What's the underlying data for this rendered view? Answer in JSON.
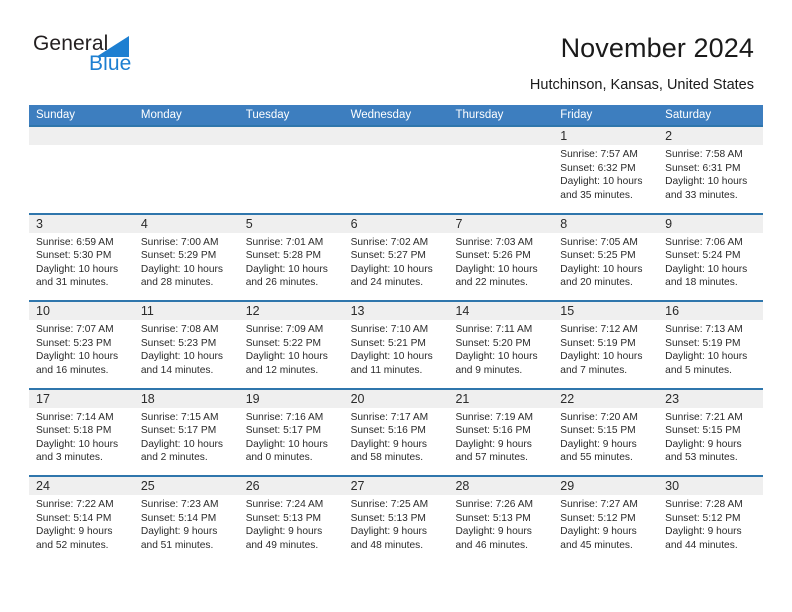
{
  "branding": {
    "logo_text_primary": "General",
    "logo_text_secondary": "Blue",
    "logo_icon": "triangle-icon",
    "accent_blue": "#1d7fd1"
  },
  "header": {
    "title": "November 2024",
    "location": "Hutchinson, Kansas, United States"
  },
  "colors": {
    "header_bar": "#3d7ebf",
    "row_divider": "#2f76ac",
    "daynum_strip": "#efefef",
    "text": "#2b2b2b"
  },
  "weekday_headers": [
    "Sunday",
    "Monday",
    "Tuesday",
    "Wednesday",
    "Thursday",
    "Friday",
    "Saturday"
  ],
  "weeks": [
    [
      {
        "day": "",
        "sunrise": "",
        "sunset": "",
        "daylight": ""
      },
      {
        "day": "",
        "sunrise": "",
        "sunset": "",
        "daylight": ""
      },
      {
        "day": "",
        "sunrise": "",
        "sunset": "",
        "daylight": ""
      },
      {
        "day": "",
        "sunrise": "",
        "sunset": "",
        "daylight": ""
      },
      {
        "day": "",
        "sunrise": "",
        "sunset": "",
        "daylight": ""
      },
      {
        "day": "1",
        "sunrise": "Sunrise: 7:57 AM",
        "sunset": "Sunset: 6:32 PM",
        "daylight": "Daylight: 10 hours and 35 minutes."
      },
      {
        "day": "2",
        "sunrise": "Sunrise: 7:58 AM",
        "sunset": "Sunset: 6:31 PM",
        "daylight": "Daylight: 10 hours and 33 minutes."
      }
    ],
    [
      {
        "day": "3",
        "sunrise": "Sunrise: 6:59 AM",
        "sunset": "Sunset: 5:30 PM",
        "daylight": "Daylight: 10 hours and 31 minutes."
      },
      {
        "day": "4",
        "sunrise": "Sunrise: 7:00 AM",
        "sunset": "Sunset: 5:29 PM",
        "daylight": "Daylight: 10 hours and 28 minutes."
      },
      {
        "day": "5",
        "sunrise": "Sunrise: 7:01 AM",
        "sunset": "Sunset: 5:28 PM",
        "daylight": "Daylight: 10 hours and 26 minutes."
      },
      {
        "day": "6",
        "sunrise": "Sunrise: 7:02 AM",
        "sunset": "Sunset: 5:27 PM",
        "daylight": "Daylight: 10 hours and 24 minutes."
      },
      {
        "day": "7",
        "sunrise": "Sunrise: 7:03 AM",
        "sunset": "Sunset: 5:26 PM",
        "daylight": "Daylight: 10 hours and 22 minutes."
      },
      {
        "day": "8",
        "sunrise": "Sunrise: 7:05 AM",
        "sunset": "Sunset: 5:25 PM",
        "daylight": "Daylight: 10 hours and 20 minutes."
      },
      {
        "day": "9",
        "sunrise": "Sunrise: 7:06 AM",
        "sunset": "Sunset: 5:24 PM",
        "daylight": "Daylight: 10 hours and 18 minutes."
      }
    ],
    [
      {
        "day": "10",
        "sunrise": "Sunrise: 7:07 AM",
        "sunset": "Sunset: 5:23 PM",
        "daylight": "Daylight: 10 hours and 16 minutes."
      },
      {
        "day": "11",
        "sunrise": "Sunrise: 7:08 AM",
        "sunset": "Sunset: 5:23 PM",
        "daylight": "Daylight: 10 hours and 14 minutes."
      },
      {
        "day": "12",
        "sunrise": "Sunrise: 7:09 AM",
        "sunset": "Sunset: 5:22 PM",
        "daylight": "Daylight: 10 hours and 12 minutes."
      },
      {
        "day": "13",
        "sunrise": "Sunrise: 7:10 AM",
        "sunset": "Sunset: 5:21 PM",
        "daylight": "Daylight: 10 hours and 11 minutes."
      },
      {
        "day": "14",
        "sunrise": "Sunrise: 7:11 AM",
        "sunset": "Sunset: 5:20 PM",
        "daylight": "Daylight: 10 hours and 9 minutes."
      },
      {
        "day": "15",
        "sunrise": "Sunrise: 7:12 AM",
        "sunset": "Sunset: 5:19 PM",
        "daylight": "Daylight: 10 hours and 7 minutes."
      },
      {
        "day": "16",
        "sunrise": "Sunrise: 7:13 AM",
        "sunset": "Sunset: 5:19 PM",
        "daylight": "Daylight: 10 hours and 5 minutes."
      }
    ],
    [
      {
        "day": "17",
        "sunrise": "Sunrise: 7:14 AM",
        "sunset": "Sunset: 5:18 PM",
        "daylight": "Daylight: 10 hours and 3 minutes."
      },
      {
        "day": "18",
        "sunrise": "Sunrise: 7:15 AM",
        "sunset": "Sunset: 5:17 PM",
        "daylight": "Daylight: 10 hours and 2 minutes."
      },
      {
        "day": "19",
        "sunrise": "Sunrise: 7:16 AM",
        "sunset": "Sunset: 5:17 PM",
        "daylight": "Daylight: 10 hours and 0 minutes."
      },
      {
        "day": "20",
        "sunrise": "Sunrise: 7:17 AM",
        "sunset": "Sunset: 5:16 PM",
        "daylight": "Daylight: 9 hours and 58 minutes."
      },
      {
        "day": "21",
        "sunrise": "Sunrise: 7:19 AM",
        "sunset": "Sunset: 5:16 PM",
        "daylight": "Daylight: 9 hours and 57 minutes."
      },
      {
        "day": "22",
        "sunrise": "Sunrise: 7:20 AM",
        "sunset": "Sunset: 5:15 PM",
        "daylight": "Daylight: 9 hours and 55 minutes."
      },
      {
        "day": "23",
        "sunrise": "Sunrise: 7:21 AM",
        "sunset": "Sunset: 5:15 PM",
        "daylight": "Daylight: 9 hours and 53 minutes."
      }
    ],
    [
      {
        "day": "24",
        "sunrise": "Sunrise: 7:22 AM",
        "sunset": "Sunset: 5:14 PM",
        "daylight": "Daylight: 9 hours and 52 minutes."
      },
      {
        "day": "25",
        "sunrise": "Sunrise: 7:23 AM",
        "sunset": "Sunset: 5:14 PM",
        "daylight": "Daylight: 9 hours and 51 minutes."
      },
      {
        "day": "26",
        "sunrise": "Sunrise: 7:24 AM",
        "sunset": "Sunset: 5:13 PM",
        "daylight": "Daylight: 9 hours and 49 minutes."
      },
      {
        "day": "27",
        "sunrise": "Sunrise: 7:25 AM",
        "sunset": "Sunset: 5:13 PM",
        "daylight": "Daylight: 9 hours and 48 minutes."
      },
      {
        "day": "28",
        "sunrise": "Sunrise: 7:26 AM",
        "sunset": "Sunset: 5:13 PM",
        "daylight": "Daylight: 9 hours and 46 minutes."
      },
      {
        "day": "29",
        "sunrise": "Sunrise: 7:27 AM",
        "sunset": "Sunset: 5:12 PM",
        "daylight": "Daylight: 9 hours and 45 minutes."
      },
      {
        "day": "30",
        "sunrise": "Sunrise: 7:28 AM",
        "sunset": "Sunset: 5:12 PM",
        "daylight": "Daylight: 9 hours and 44 minutes."
      }
    ]
  ]
}
